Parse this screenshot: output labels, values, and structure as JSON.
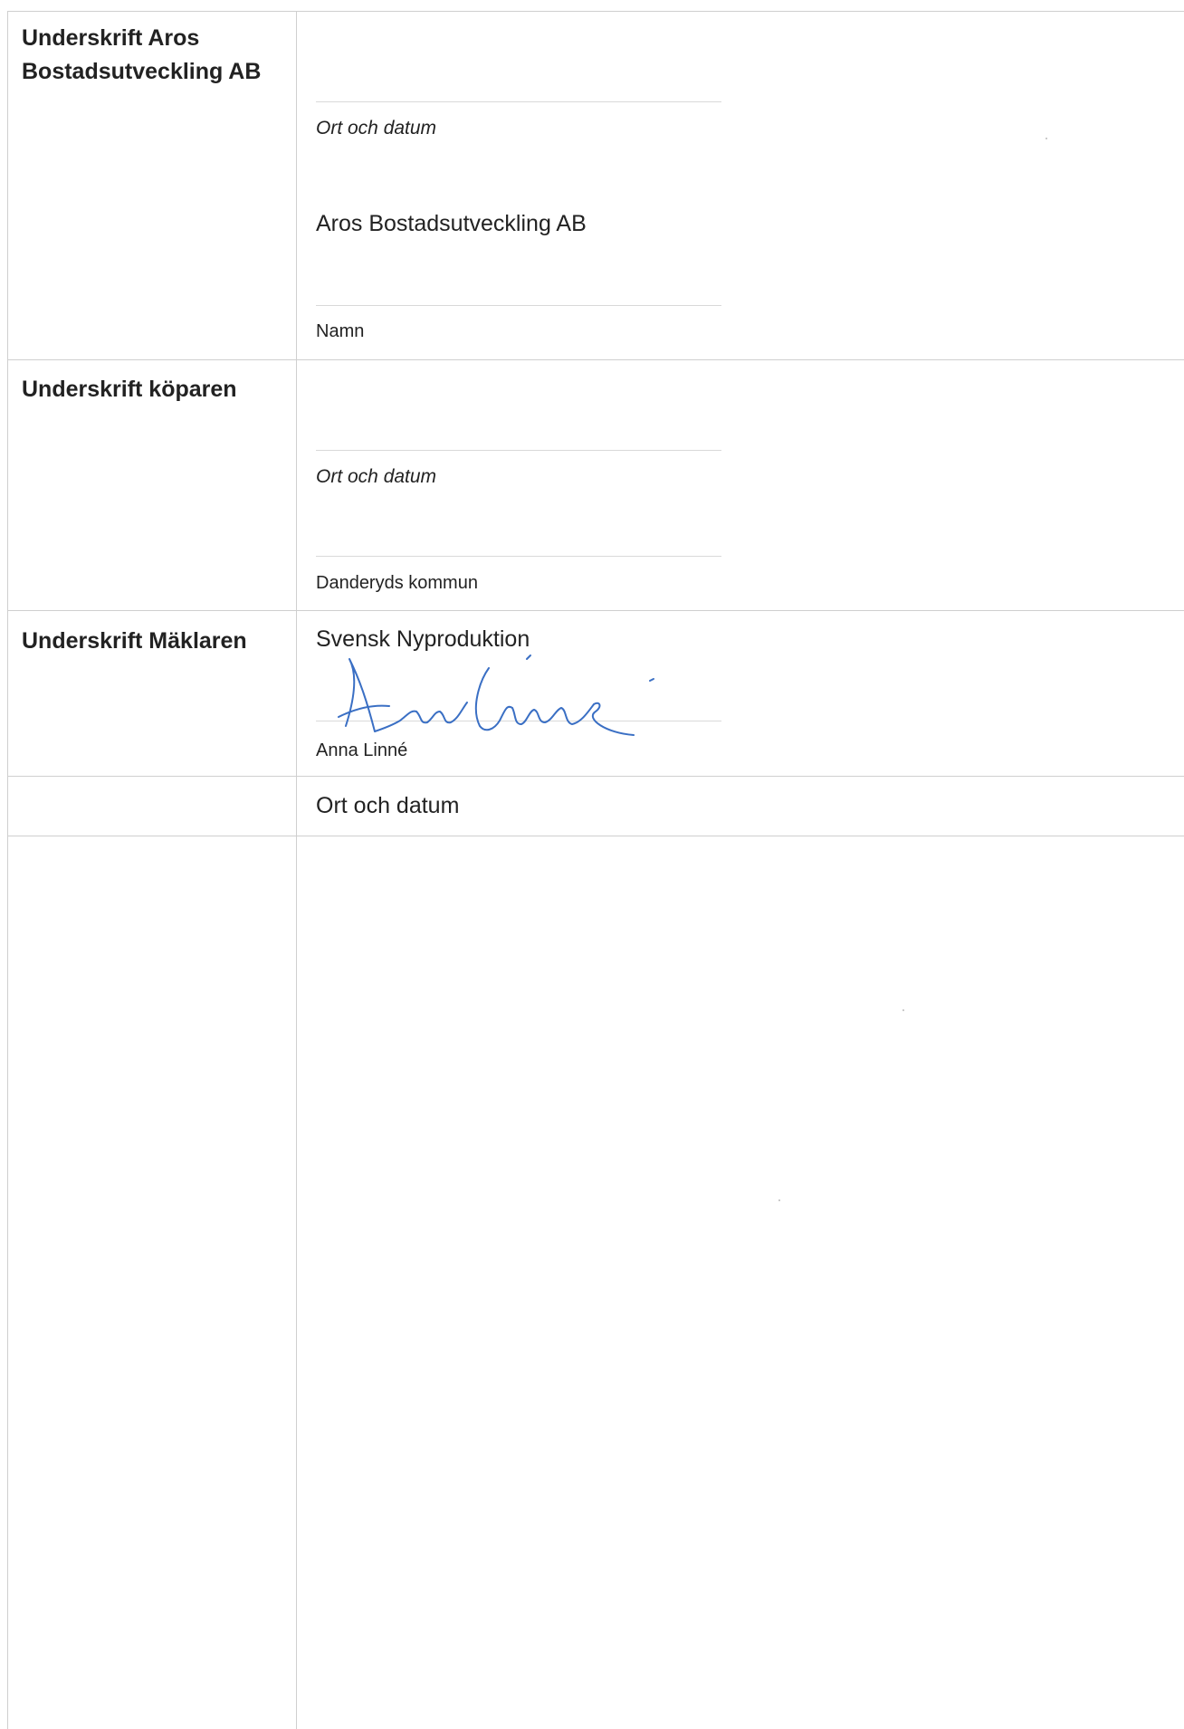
{
  "rows": {
    "aros": {
      "label": "Underskrift Aros Bostadsutveckling AB",
      "place_date_caption": "Ort och datum",
      "company_name": "Aros Bostadsutveckling AB",
      "name_caption": "Namn"
    },
    "buyer": {
      "label": "Underskrift köparen",
      "place_date_caption": "Ort och datum",
      "name_caption": "Danderyds kommun"
    },
    "broker": {
      "label": "Underskrift Mäklaren",
      "company_name": "Svensk Nyproduktion",
      "signer_name": "Anna Linné"
    },
    "broker_date": {
      "text": "Ort och datum"
    }
  },
  "signature": {
    "signer": "Anna Linné",
    "ink_color": "#3a6fc4"
  }
}
